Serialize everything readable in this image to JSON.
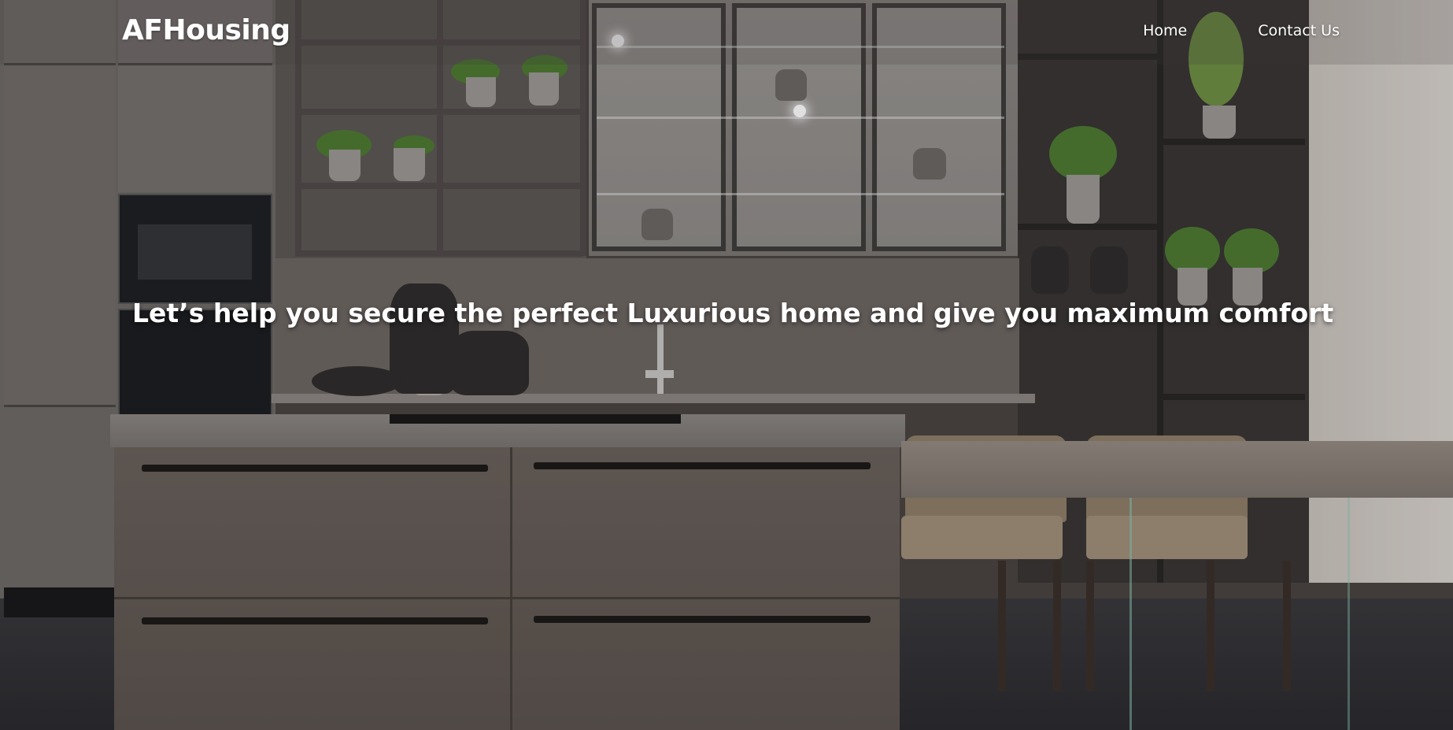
{
  "header": {
    "logo_text": "AFHousing",
    "nav": [
      {
        "label": "Home"
      },
      {
        "label": "Contact Us"
      }
    ]
  },
  "hero": {
    "heading": "Let’s help you secure the perfect Luxurious home and give you maximum comfort",
    "background_image": "modern-kitchen-photo"
  }
}
